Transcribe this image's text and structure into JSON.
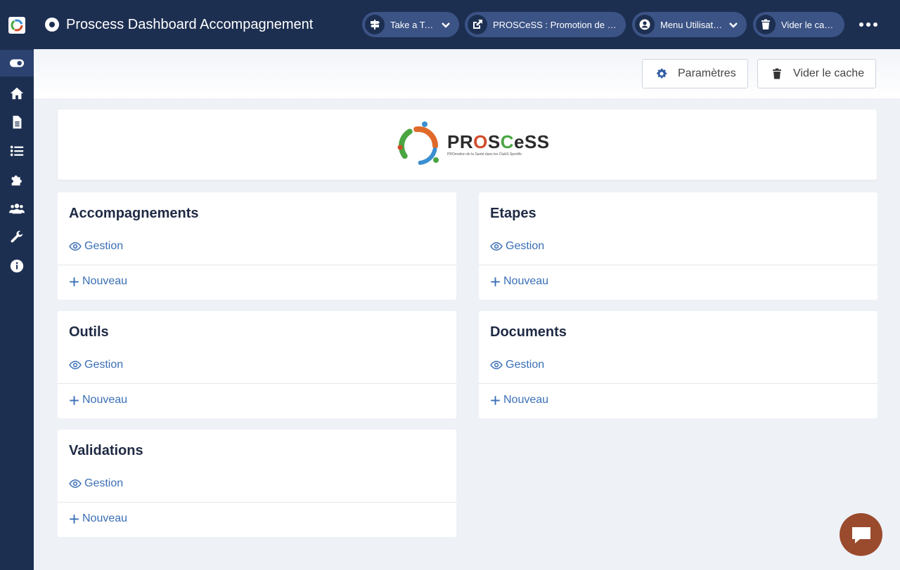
{
  "header": {
    "title": "Proscess Dashboard Accompagnement",
    "pills": [
      {
        "label": "Take a Tour",
        "icon": "signpost-icon"
      },
      {
        "label": "PROSCeSS : Promotion de la S...",
        "icon": "external-link-icon"
      },
      {
        "label": "Menu Utilisateur",
        "icon": "user-circle-icon"
      },
      {
        "label": "Vider le cache",
        "icon": "trash-icon"
      }
    ]
  },
  "toolbar": {
    "settings_label": "Paramètres",
    "clear_cache_label": "Vider le cache"
  },
  "logo": {
    "name_part1": "PR",
    "name_o": "O",
    "name_s": "S",
    "name_c": "C",
    "name_rest": "eSS",
    "tagline": "PROmotion de la Santé dans les ClubS Sportifs"
  },
  "sections": [
    {
      "title": "Accompagnements",
      "view_label": "Gestion",
      "new_label": "Nouveau"
    },
    {
      "title": "Etapes",
      "view_label": "Gestion",
      "new_label": "Nouveau"
    },
    {
      "title": "Outils",
      "view_label": "Gestion",
      "new_label": "Nouveau"
    },
    {
      "title": "Documents",
      "view_label": "Gestion",
      "new_label": "Nouveau"
    },
    {
      "title": "Validations",
      "view_label": "Gestion",
      "new_label": "Nouveau"
    }
  ],
  "sidebar": {
    "items": [
      {
        "icon": "toggle-icon",
        "active": true
      },
      {
        "icon": "home-icon"
      },
      {
        "icon": "file-icon"
      },
      {
        "icon": "list-icon"
      },
      {
        "icon": "puzzle-icon"
      },
      {
        "icon": "users-icon"
      },
      {
        "icon": "wrench-icon"
      },
      {
        "icon": "info-icon"
      }
    ]
  },
  "colors": {
    "sidebar_bg": "#1d2f51",
    "pill_bg": "#3b5385",
    "link": "#3a6fb5",
    "chat_bg": "#9a4b2d"
  }
}
